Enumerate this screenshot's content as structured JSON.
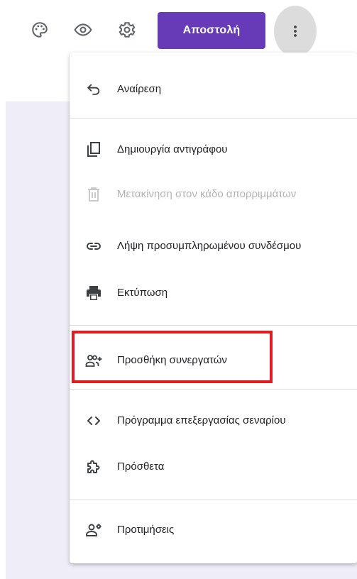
{
  "header": {
    "icons": [
      "palette-icon",
      "preview-eye-icon",
      "settings-gear-icon",
      "more-vert-icon"
    ],
    "send_label": "Αποστολή"
  },
  "menu": {
    "items": [
      {
        "label": "Αναίρεση",
        "icon": "undo-icon",
        "enabled": true
      },
      {
        "label": "Δημιουργία αντιγράφου",
        "icon": "copy-icon",
        "enabled": true
      },
      {
        "label": "Μετακίνηση στον κάδο απορριμμάτων",
        "icon": "trash-icon",
        "enabled": false
      },
      {
        "label": "Λήψη προσυμπληρωμένου συνδέσμου",
        "icon": "link-icon",
        "enabled": true
      },
      {
        "label": "Εκτύπωση",
        "icon": "print-icon",
        "enabled": true
      },
      {
        "label": "Προσθήκη συνεργατών",
        "icon": "add-people-icon",
        "enabled": true,
        "highlighted": true
      },
      {
        "label": "Πρόγραμμα επεξεργασίας σεναρίου",
        "icon": "code-brackets-icon",
        "enabled": true
      },
      {
        "label": "Πρόσθετα",
        "icon": "puzzle-icon",
        "enabled": true
      },
      {
        "label": "Προτιμήσεις",
        "icon": "person-settings-icon",
        "enabled": true
      }
    ]
  },
  "colors": {
    "accent": "#673ab7",
    "highlight_border": "#e11b22",
    "disabled_text": "#b3b3b3",
    "page_background": "#efedf7"
  }
}
